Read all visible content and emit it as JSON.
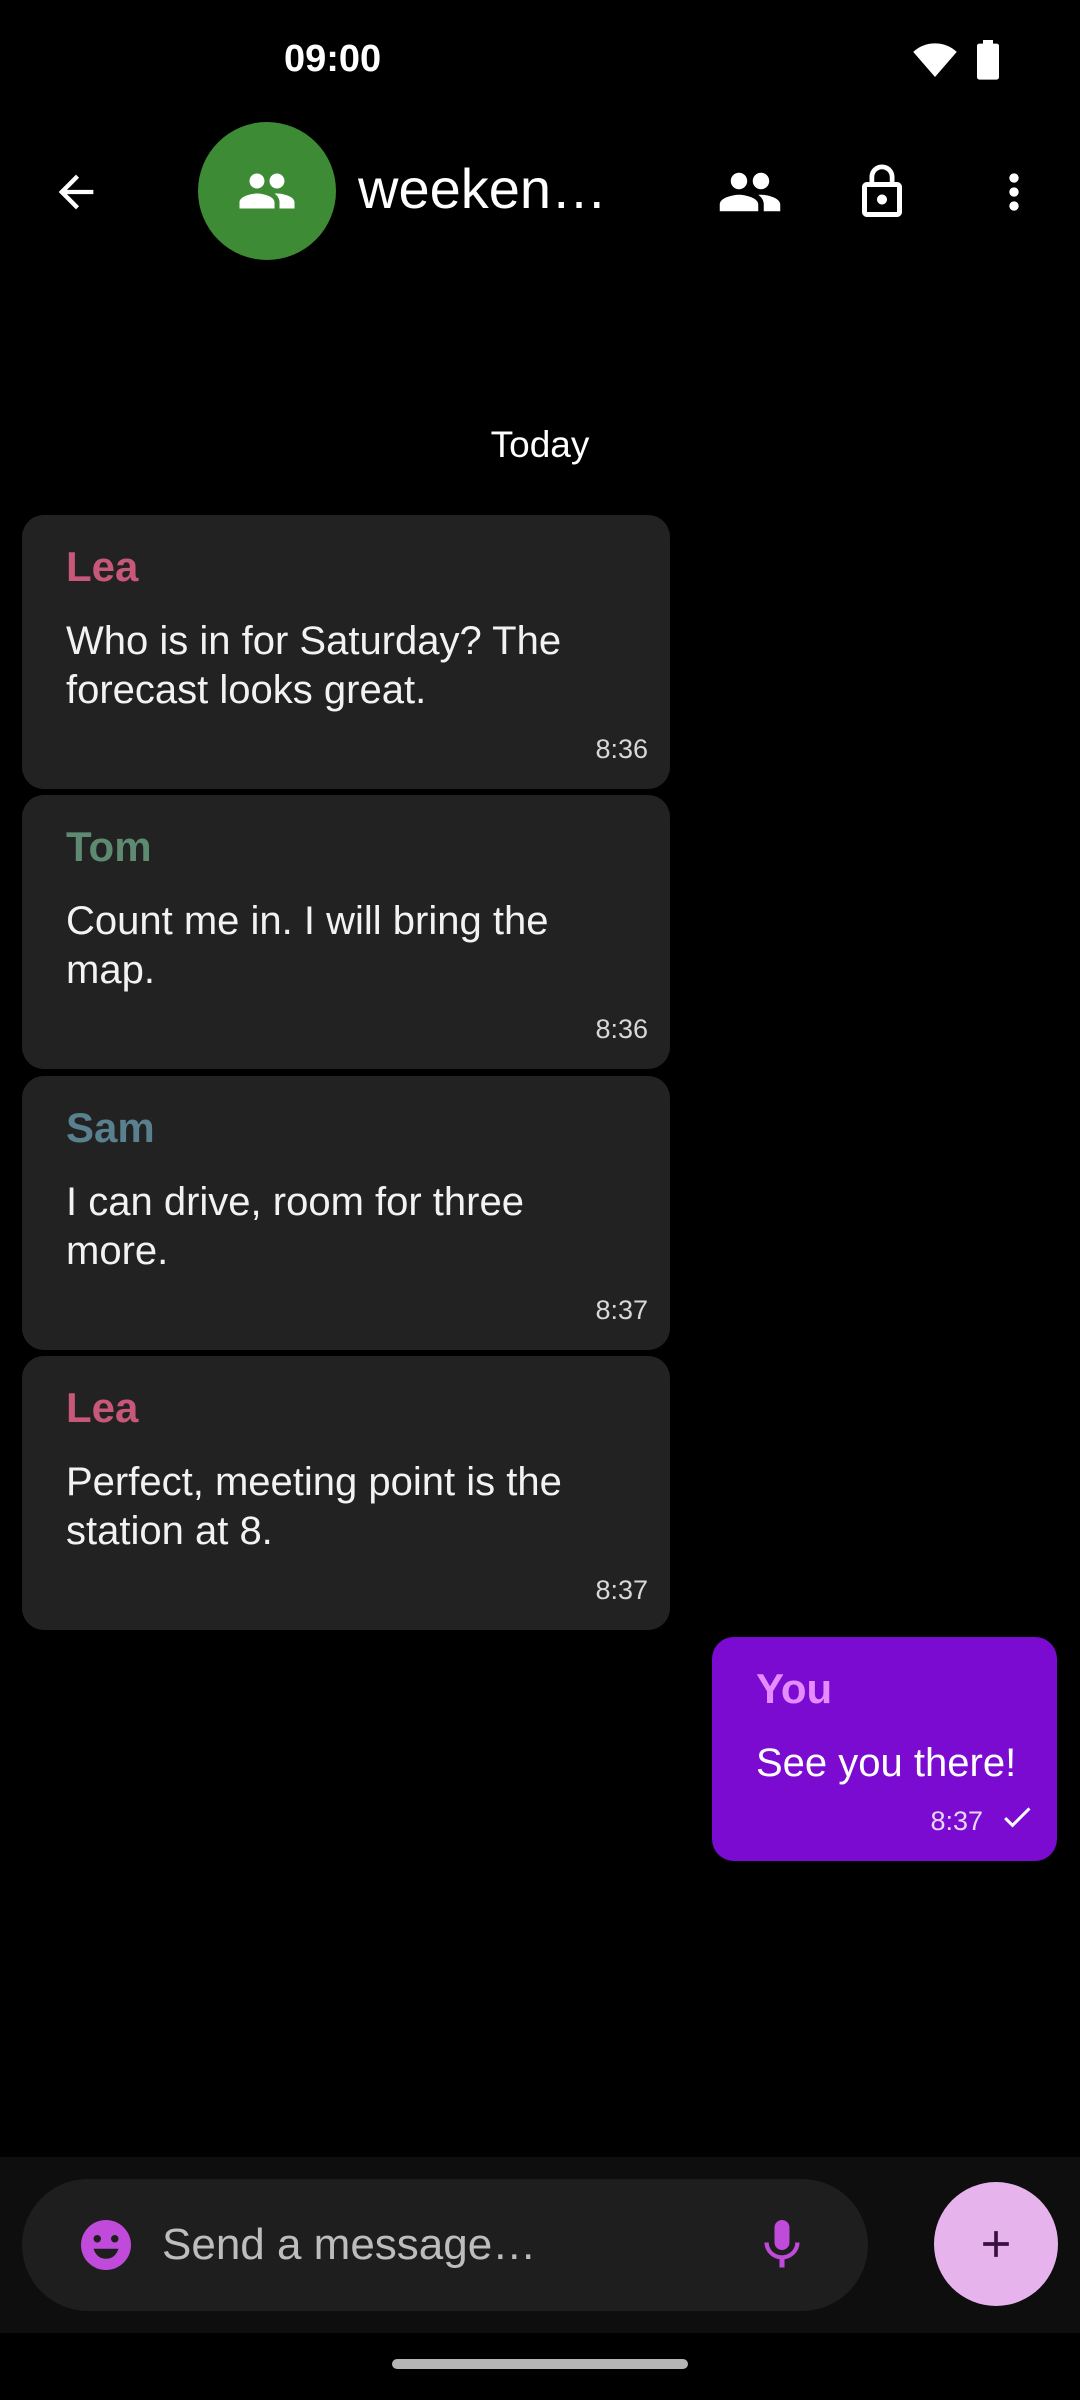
{
  "status_bar": {
    "time": "09:00",
    "icons": [
      "wifi-icon",
      "battery-icon"
    ]
  },
  "app_bar": {
    "back_icon": "arrow-left-icon",
    "avatar_icon": "group-icon",
    "avatar_color": "#3d8b34",
    "title": "weekend…",
    "actions": [
      "members-icon",
      "lock-icon",
      "more-vert-icon"
    ]
  },
  "chat": {
    "date_divider": "Today",
    "messages": [
      {
        "sender": "Lea",
        "sender_color": "#c8587a",
        "text": "Who is in for Saturday? The forecast looks great.",
        "time": "8:36",
        "own": false
      },
      {
        "sender": "Tom",
        "sender_color": "#5f8a72",
        "text": "Count me in. I will bring the map.",
        "time": "8:36",
        "own": false
      },
      {
        "sender": "Sam",
        "sender_color": "#58808f",
        "text": "I can drive, room for three more.",
        "time": "8:37",
        "own": false
      },
      {
        "sender": "Lea",
        "sender_color": "#c8587a",
        "text": "Perfect, meeting point is the station at 8.",
        "time": "8:37",
        "own": false
      },
      {
        "sender": "You",
        "sender_color": "#e58cff",
        "text": "See you there!",
        "time": "8:37",
        "own": true,
        "status_icon": "check-icon"
      }
    ]
  },
  "composer": {
    "placeholder": "Send a message…",
    "emoji_icon": "emoji-icon",
    "mic_icon": "mic-icon",
    "fab_icon": "plus-icon",
    "accent_color": "#c04ad9"
  },
  "colors": {
    "background": "#000000",
    "bubble_incoming": "#222222",
    "bubble_outgoing": "#7b0bd0",
    "fab": "#e6b3ed"
  }
}
